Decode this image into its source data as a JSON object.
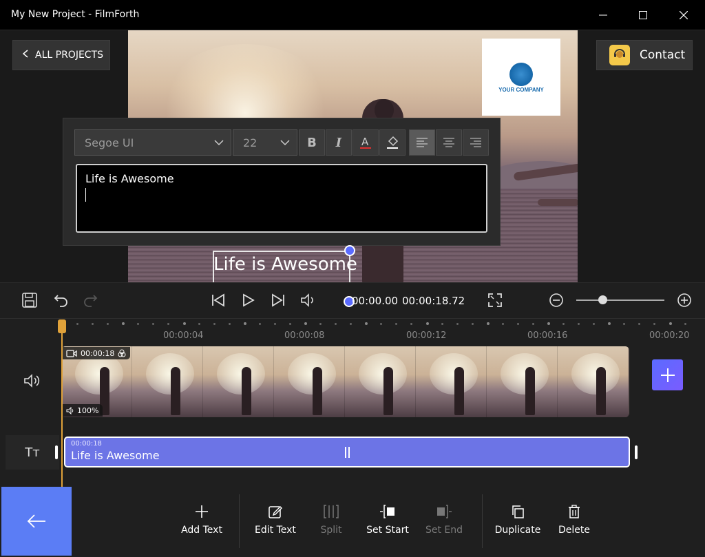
{
  "window": {
    "title": "My New Project - FilmForth"
  },
  "header": {
    "all_projects_label": "ALL PROJECTS",
    "contact_label": "Contact"
  },
  "preview": {
    "logo_text": "YOUR COMPANY",
    "overlay_text": "Life is Awesome"
  },
  "text_editor": {
    "font": "Segoe UI",
    "size": "22",
    "content": "Life is Awesome",
    "alignment": "left"
  },
  "player": {
    "current_time": "00:00.00",
    "total_time": "00:00:18.72",
    "zoom_level": 0.3
  },
  "timeline": {
    "ruler": [
      "00:00:04",
      "00:00:08",
      "00:00:12",
      "00:00:16",
      "00:00:20"
    ],
    "video_clip": {
      "duration": "00:00:18",
      "volume": "100%"
    },
    "text_clip": {
      "time": "00:00:18",
      "label": "Life is Awesome"
    },
    "text_track_label": "Tт"
  },
  "actions": [
    {
      "label": "Add Text",
      "enabled": true
    },
    {
      "label": "Edit Text",
      "enabled": true
    },
    {
      "label": "Split",
      "enabled": false
    },
    {
      "label": "Set Start",
      "enabled": true
    },
    {
      "label": "Set End",
      "enabled": false
    },
    {
      "label": "Duplicate",
      "enabled": true
    },
    {
      "label": "Delete",
      "enabled": true
    }
  ],
  "colors": {
    "accent": "#5b6bff",
    "back_button": "#5b7df5",
    "playhead": "#e0a23a",
    "contact_avatar": "#f4c94a"
  }
}
